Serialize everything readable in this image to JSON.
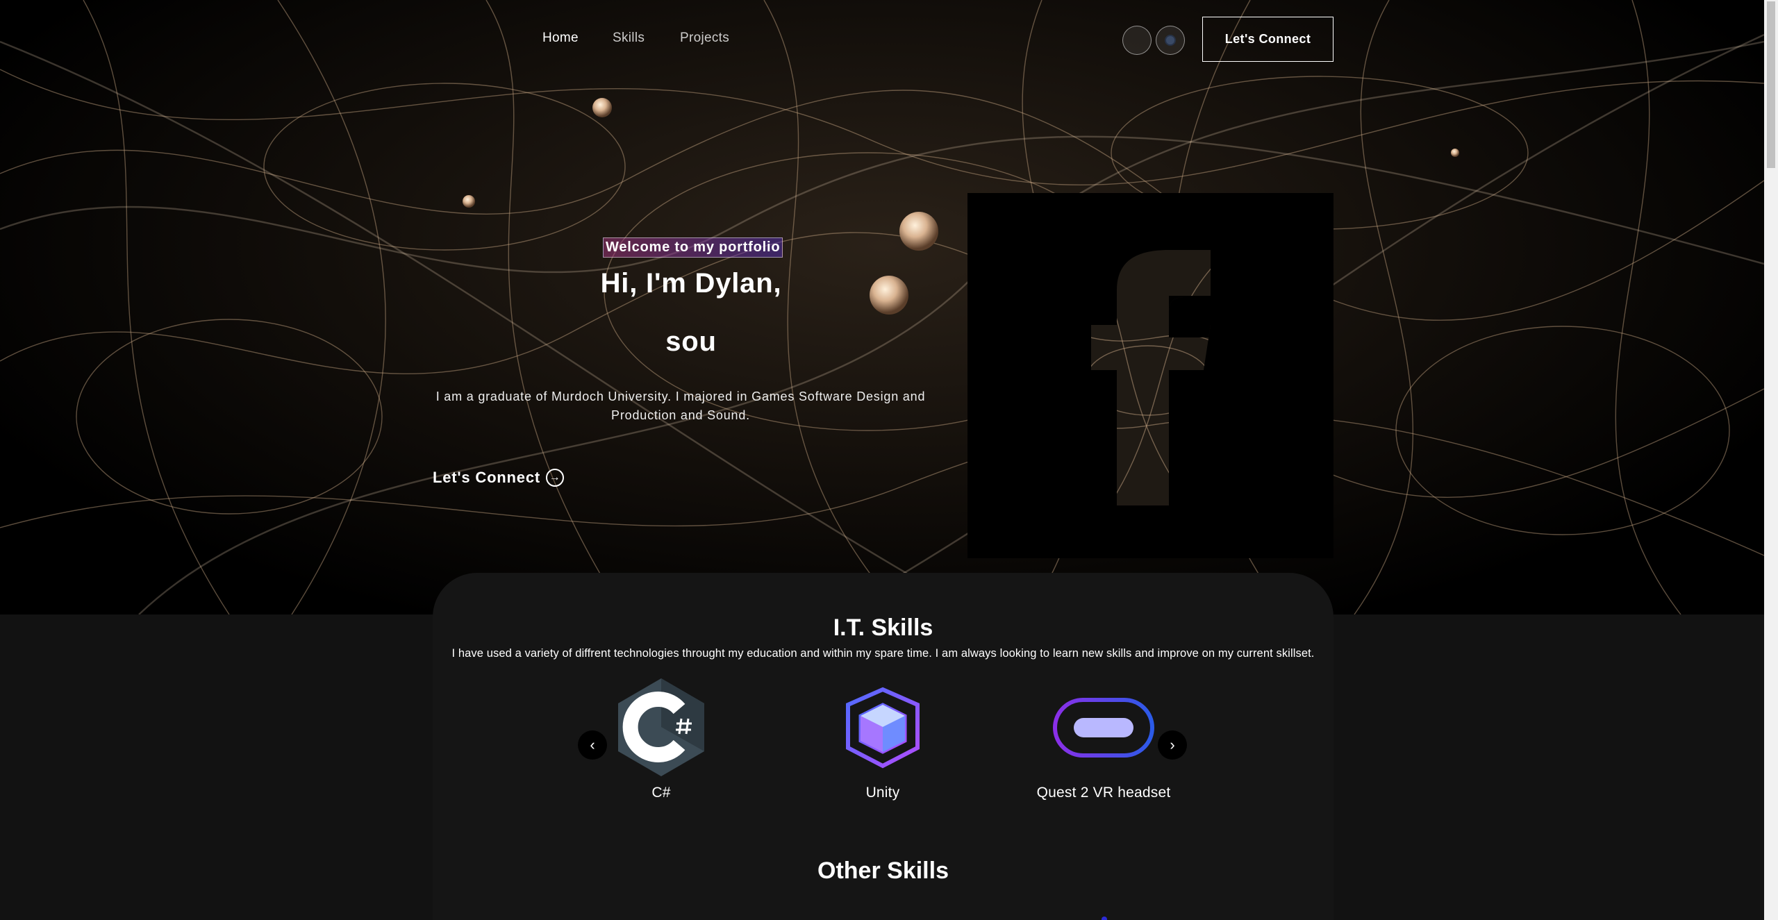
{
  "nav": {
    "links": [
      {
        "label": "Home"
      },
      {
        "label": "Skills"
      },
      {
        "label": "Projects"
      }
    ],
    "social": [
      {
        "icon": "linkedin-icon"
      },
      {
        "icon": "github-icon"
      }
    ],
    "connect_label": "Let's Connect"
  },
  "banner": {
    "tagline": "Welcome to my portfolio",
    "headline_line1": "Hi, I'm Dylan,",
    "headline_line2": "sou",
    "bio": "I am a graduate of Murdoch University. I majored in Games Software Design and Production and Sound.",
    "cta_label": "Let's Connect",
    "header_icon": "facebook-f-icon"
  },
  "skills": {
    "title": "I.T. Skills",
    "description": "I have used a variety of diffrent technologies throught my education and within my spare time. I am always looking to learn new skills and improve on my current skillset.",
    "items": [
      {
        "name": "C#",
        "icon": "csharp-logo-icon"
      },
      {
        "name": "Unity",
        "icon": "unity-logo-icon"
      },
      {
        "name": "Quest 2 VR headset",
        "icon": "vr-headset-icon"
      }
    ],
    "prev_icon": "chevron-left-icon",
    "next_icon": "chevron-right-icon"
  },
  "other_skills": {
    "title": "Other Skills"
  },
  "colors": {
    "background": "#000000",
    "section": "#121212",
    "accent_pink": "#aa367c",
    "accent_purple": "#4a2fbd"
  }
}
